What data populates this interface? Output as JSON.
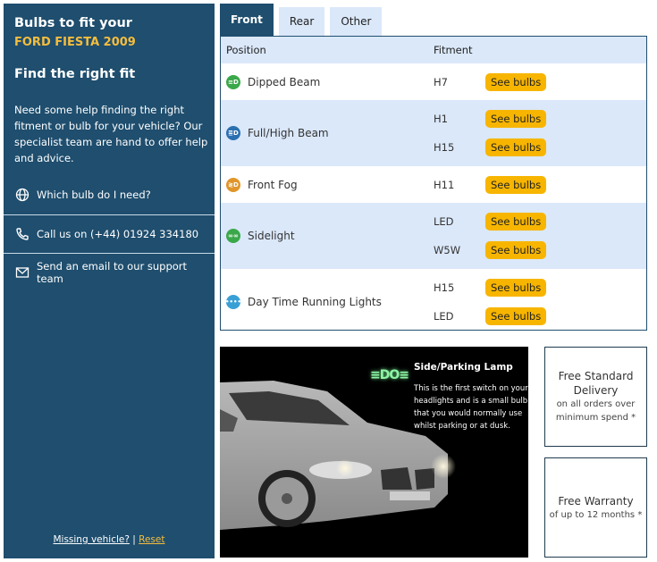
{
  "sidebar": {
    "title": "Bulbs to fit your",
    "vehicle": "FORD FIESTA 2009",
    "heading": "Find the right fit",
    "help_text": "Need some help finding the right fitment or bulb for your vehicle? Our specialist team are hand to offer help and advice.",
    "links": [
      {
        "icon": "globe-icon",
        "label": "Which bulb do I need?"
      },
      {
        "icon": "phone-icon",
        "label": "Call us on (+44) 01924 334180"
      },
      {
        "icon": "envelope-icon",
        "label": "Send an email to our support team"
      }
    ],
    "footer": {
      "missing": "Missing vehicle?",
      "separator": "|",
      "reset": "Reset"
    },
    "colors": {
      "background": "#1f4e6e",
      "accent": "#f5bd3e"
    }
  },
  "tabs": [
    {
      "label": "Front",
      "active": true
    },
    {
      "label": "Rear",
      "active": false
    },
    {
      "label": "Other",
      "active": false
    }
  ],
  "table": {
    "headers": {
      "position": "Position",
      "fitment": "Fitment"
    },
    "button_label": "See bulbs",
    "rows": [
      {
        "position": "Dipped Beam",
        "icon": "dipped-beam-icon",
        "icon_color": "#3aa84a",
        "fitments": [
          "H7"
        ]
      },
      {
        "position": "Full/High Beam",
        "icon": "high-beam-icon",
        "icon_color": "#2a6fb0",
        "fitments": [
          "H1",
          "H15"
        ]
      },
      {
        "position": "Front Fog",
        "icon": "fog-light-icon",
        "icon_color": "#e0962a",
        "fitments": [
          "H11"
        ]
      },
      {
        "position": "Sidelight",
        "icon": "sidelight-icon",
        "icon_color": "#3aa84a",
        "fitments": [
          "LED",
          "W5W"
        ]
      },
      {
        "position": "Day Time Running Lights",
        "icon": "drl-icon",
        "icon_color": "#39a0d6",
        "fitments": [
          "H15",
          "LED"
        ]
      }
    ]
  },
  "promo": {
    "icon": "side-parking-lamp-icon",
    "icon_glyph": "≡DO≡",
    "title": "Side/Parking Lamp",
    "text": "This is the first switch on your headlights and is a small bulb that you would normally use whilst parking or at dusk."
  },
  "info_boxes": [
    {
      "title": "Free Standard Delivery",
      "subtitle": "on all orders over minimum spend *"
    },
    {
      "title": "Free Warranty",
      "subtitle": "of up to 12 months *"
    }
  ]
}
